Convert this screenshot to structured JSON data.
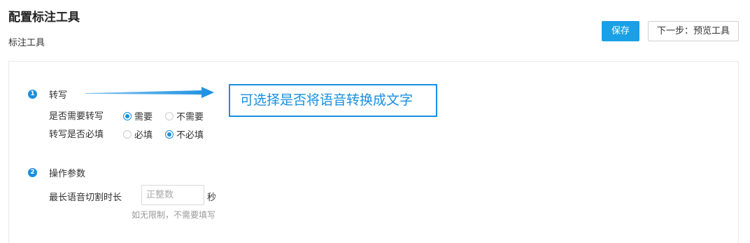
{
  "header": {
    "title": "配置标注工具",
    "subtitle": "标注工具"
  },
  "toolbar": {
    "save_label": "保存",
    "next_label": "下一步：预览工具"
  },
  "sections": [
    {
      "number": "1",
      "title": "转写",
      "fields": [
        {
          "label": "是否需要转写",
          "options": [
            "需要",
            "不需要"
          ],
          "selected": "需要"
        },
        {
          "label": "转写是否必填",
          "options": [
            "必填",
            "不必填"
          ],
          "selected": "不必填"
        }
      ]
    },
    {
      "number": "2",
      "title": "操作参数",
      "fields": [
        {
          "label": "最长语音切割时长",
          "placeholder": "正整数",
          "value": "",
          "unit": "秒",
          "hint": "如无限制，不需要填写"
        }
      ]
    }
  ],
  "annotation": {
    "text": "可选择是否将语音转换成文字",
    "color": "#1a8fe0"
  },
  "colors": {
    "primary": "#1aa0e6",
    "accent": "#1a8fe0"
  }
}
